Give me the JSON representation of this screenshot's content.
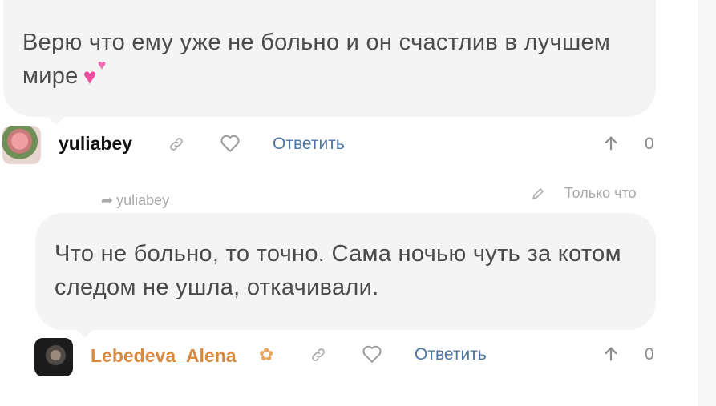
{
  "comments": [
    {
      "text": "Верю что ему уже не больно и он счастлив в лучшем мире",
      "emoji": "💕",
      "author": "yuliabey",
      "reply_label": "Ответить",
      "upvotes": "0",
      "icons": [
        "link-icon",
        "heart-icon",
        "arrow-up-icon"
      ]
    },
    {
      "reply_to": "yuliabey",
      "time": "Только что",
      "text": "Что не больно, то точно. Сама ночью чуть за котом следом не ушла, откачивали.",
      "author": "Lebedeva_Alena",
      "author_badge": "butterfly-icon",
      "reply_label": "Ответить",
      "upvotes": "0",
      "icons": [
        "edit-icon",
        "link-icon",
        "heart-icon",
        "arrow-up-icon"
      ]
    }
  ],
  "colors": {
    "bubble_bg": "#f4f4f5",
    "reply_link": "#4b76a6",
    "author2": "#d98a3e"
  }
}
